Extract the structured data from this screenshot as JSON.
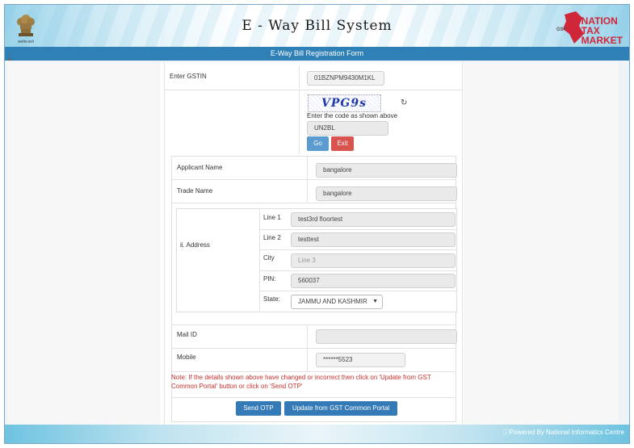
{
  "header": {
    "emblem_caption": "सत्यमेव जयते",
    "title": "E - Way Bill System",
    "logo_lines": [
      "NATION",
      "TAX",
      "MARKET"
    ],
    "logo_badge": "GST"
  },
  "banner": {
    "title": "E-Way Bill Registration Form"
  },
  "gstin": {
    "label": "Enter GSTIN",
    "value": "01BZNPM9430M1KL"
  },
  "captcha": {
    "code": "VPG9s",
    "refresh_icon": "refresh-icon",
    "hint": "Enter the code as shown above",
    "value": "UN2BL"
  },
  "buttons": {
    "go": "Go",
    "exit": "Exit",
    "send_otp": "Send OTP",
    "update": "Update from GST Common Portal"
  },
  "applicant": {
    "label": "Applicant Name",
    "value": "bangalore"
  },
  "trade": {
    "label": "Trade Name",
    "value": "bangalore"
  },
  "address": {
    "label": "ii. Address",
    "line1_label": "Line 1",
    "line1_value": "test3rd floortest",
    "line2_label": "Line 2",
    "line2_value": "testtest",
    "city_label": "City",
    "city_placeholder": "Line 3",
    "pin_label": "PIN:",
    "pin_value": "560037",
    "state_label": "State:",
    "state_value": "JAMMU AND KASHMIR"
  },
  "mail": {
    "label": "Mail ID",
    "value": ""
  },
  "mobile": {
    "label": "Mobile",
    "value": "******5523"
  },
  "note": "Note: If the details shown above have changed or incorrect then click on 'Update from GST Common Portal' button or click on 'Send OTP'",
  "footer": {
    "text": "Powered By National Informatics Centre"
  },
  "colors": {
    "banner": "#2f80b7",
    "go": "#5b9bd0",
    "exit": "#d9534f",
    "primary": "#337ab7",
    "note": "#c9302c"
  }
}
